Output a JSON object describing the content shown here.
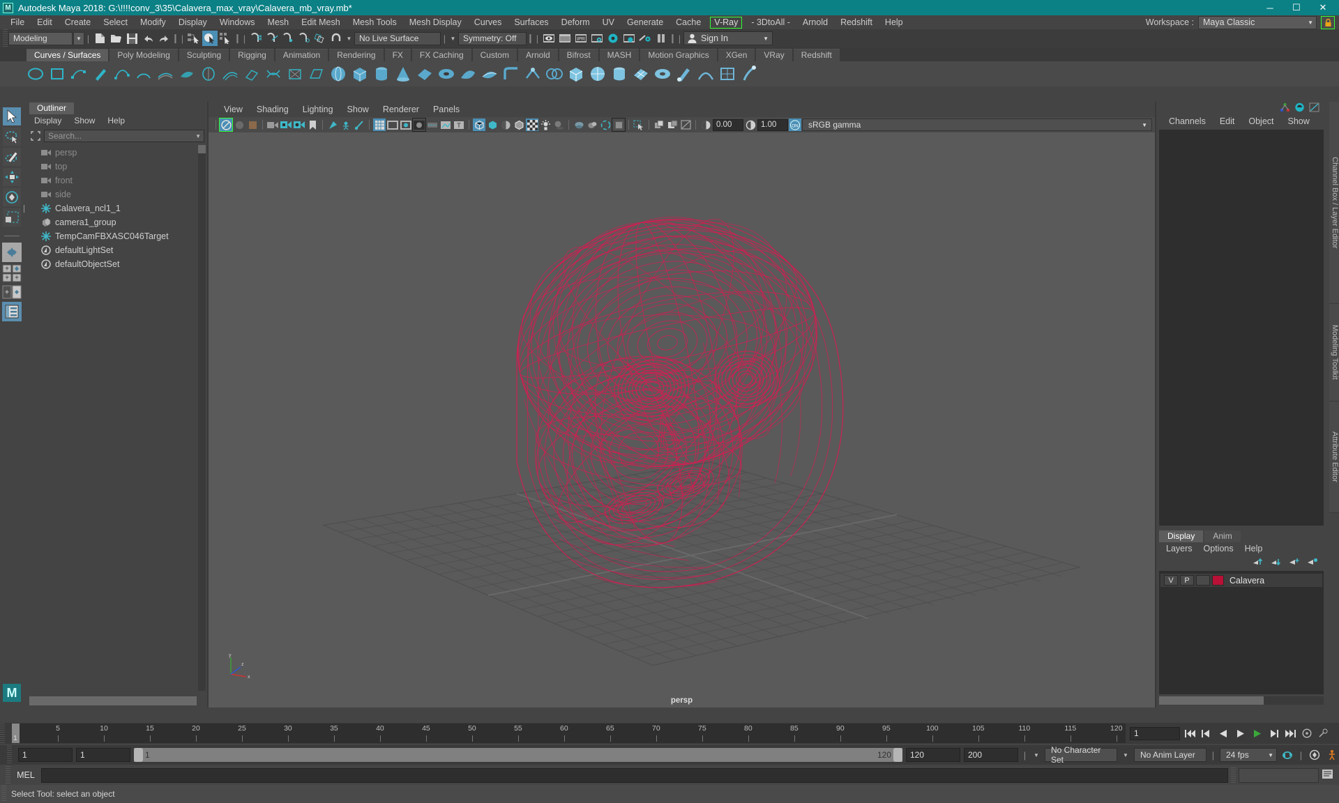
{
  "window": {
    "title": "Autodesk Maya 2018: G:\\!!!!conv_3\\35\\Calavera_max_vray\\Calavera_mb_vray.mb*",
    "logo": "M",
    "minimize": "─",
    "maximize": "☐",
    "close": "✕"
  },
  "menubar": {
    "items": [
      "File",
      "Edit",
      "Create",
      "Select",
      "Modify",
      "Display",
      "Windows",
      "Mesh",
      "Edit Mesh",
      "Mesh Tools",
      "Mesh Display",
      "Curves",
      "Surfaces",
      "Deform",
      "UV",
      "Generate",
      "Cache"
    ],
    "boxed": "V-Ray",
    "plugin": "- 3DtoAll -",
    "after": [
      "Arnold",
      "Redshift",
      "Help"
    ],
    "workspace_label": "Workspace :",
    "workspace_value": "Maya Classic",
    "lock_icon": "lock-icon",
    "caret": "▼"
  },
  "statusline": {
    "mode": "Modeling",
    "live_surface": "No Live Surface",
    "symmetry": "Symmetry: Off",
    "signin": "Sign In",
    "signin_caret": "▼",
    "caret": "▼"
  },
  "shelf": {
    "tabs": [
      "Curves / Surfaces",
      "Poly Modeling",
      "Sculpting",
      "Rigging",
      "Animation",
      "Rendering",
      "FX",
      "FX Caching",
      "Custom",
      "Arnold",
      "Bifrost",
      "MASH",
      "Motion Graphics",
      "XGen",
      "VRay",
      "Redshift"
    ],
    "active": "Curves / Surfaces"
  },
  "outliner": {
    "tab": "Outliner",
    "menu": [
      "Display",
      "Show",
      "Help"
    ],
    "search_placeholder": "Search...",
    "caret": "▼",
    "items": [
      {
        "label": "persp",
        "icon": "camera-icon",
        "dim": true,
        "expander": false
      },
      {
        "label": "top",
        "icon": "camera-icon",
        "dim": true,
        "expander": false
      },
      {
        "label": "front",
        "icon": "camera-icon",
        "dim": true,
        "expander": false
      },
      {
        "label": "side",
        "icon": "camera-icon",
        "dim": true,
        "expander": false
      },
      {
        "label": "Calavera_ncl1_1",
        "icon": "transform-icon",
        "dim": false,
        "expander": true
      },
      {
        "label": "camera1_group",
        "icon": "group-icon",
        "dim": false,
        "expander": false
      },
      {
        "label": "TempCamFBXASC046Target",
        "icon": "transform-icon",
        "dim": false,
        "expander": false
      },
      {
        "label": "defaultLightSet",
        "icon": "set-icon",
        "dim": false,
        "expander": false
      },
      {
        "label": "defaultObjectSet",
        "icon": "set-icon",
        "dim": false,
        "expander": false
      }
    ]
  },
  "viewport": {
    "menu": [
      "View",
      "Shading",
      "Lighting",
      "Show",
      "Renderer",
      "Panels"
    ],
    "exposure": "0.00",
    "gain": "1.00",
    "gamma_toggle": "ON",
    "color_space": "sRGB gamma",
    "camera_label": "persp",
    "caret": "▼",
    "axis": {
      "x": "x",
      "y": "y",
      "z": "z"
    },
    "model_color": "#d81b51",
    "bg_color": "#5a5a5a"
  },
  "channelbox": {
    "menu": [
      "Channels",
      "Edit",
      "Object",
      "Show"
    ],
    "side_tab_1": "Channel Box / Layer Editor",
    "side_tab_2": "Modeling Toolkit",
    "side_tab_3": "Attribute Editor"
  },
  "layers": {
    "tabs": [
      "Display",
      "Anim"
    ],
    "active_tab": "Display",
    "menu": [
      "Layers",
      "Options",
      "Help"
    ],
    "rows": [
      {
        "v": "V",
        "p": "P",
        "color": "#b81036",
        "name": "Calavera"
      }
    ]
  },
  "timeline": {
    "tick_labels": [
      "5",
      "10",
      "15",
      "20",
      "25",
      "30",
      "35",
      "40",
      "45",
      "50",
      "55",
      "60",
      "65",
      "70",
      "75",
      "80",
      "85",
      "90",
      "95",
      "100",
      "105",
      "110",
      "115",
      "120"
    ],
    "current_frame_marker": "1",
    "current_frame_field": "1",
    "range_start_field": "1",
    "range_anim_start": "1",
    "slider_left": "1",
    "slider_right": "120",
    "range_end_field": "120",
    "anim_end_field": "200",
    "character_set": "No Character Set",
    "anim_layer": "No Anim Layer",
    "fps": "24 fps",
    "caret": "▼"
  },
  "command": {
    "label": "MEL",
    "input_value": "",
    "placeholder": ""
  },
  "status": {
    "message": "Select Tool: select an object"
  },
  "toolbox": {
    "tools": [
      {
        "name": "select-tool",
        "selected": true
      },
      {
        "name": "lasso-select-tool",
        "selected": false
      },
      {
        "name": "paint-select-tool",
        "selected": false
      },
      {
        "name": "move-tool",
        "selected": false
      },
      {
        "name": "rotate-tool",
        "selected": false
      },
      {
        "name": "scale-tool",
        "selected": false
      }
    ],
    "layouts": [
      {
        "name": "single-pane-layout",
        "selected": false
      },
      {
        "name": "four-pane-layout",
        "selected": false
      },
      {
        "name": "two-pane-layout",
        "selected": false
      },
      {
        "name": "outliner-persp-layout",
        "selected": true
      }
    ]
  }
}
